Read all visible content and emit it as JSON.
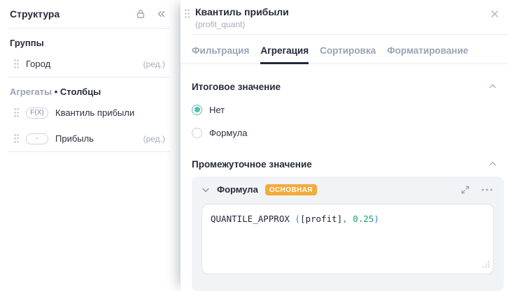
{
  "sidebar": {
    "title": "Структура",
    "groups_label": "Группы",
    "group_item": {
      "name": "Город",
      "edit_label": "(ред.)"
    },
    "aggregates_label": "Агрегаты",
    "separator": " • ",
    "columns_label": "Столбцы",
    "items": [
      {
        "badge": "F(X)",
        "name": "Квантиль прибыли",
        "edit_label": ""
      },
      {
        "badge": "-",
        "name": "Прибыль",
        "edit_label": "(ред.)"
      }
    ]
  },
  "panel": {
    "title": "Квантиль прибыли",
    "subtitle": "(profit_quant)",
    "tabs": [
      {
        "label": "Фильтрация"
      },
      {
        "label": "Агрегация"
      },
      {
        "label": "Сортировка"
      },
      {
        "label": "Форматирование"
      }
    ],
    "active_tab": "Агрегация",
    "total_section": {
      "title": "Итоговое значение",
      "options": [
        {
          "label": "Нет",
          "selected": true
        },
        {
          "label": "Формула",
          "selected": false
        }
      ]
    },
    "intermediate_section": {
      "title": "Промежуточное значение",
      "formula_label": "Формула",
      "badge": "ОСНОВНАЯ",
      "code": {
        "function": "QUANTILE_APPROX ",
        "paren_open": "(",
        "argument": "[profit]",
        "comma": ", ",
        "number": "0.25",
        "paren_close": ")"
      }
    }
  },
  "colors": {
    "accent_teal": "#57bdb4",
    "badge_orange": "#f2ab3c",
    "syntax_plain": "#23283a",
    "syntax_paren": "#3b7ef2",
    "syntax_number": "#17a168",
    "tab_active": "#23283a",
    "muted_text": "#a6acbc"
  }
}
